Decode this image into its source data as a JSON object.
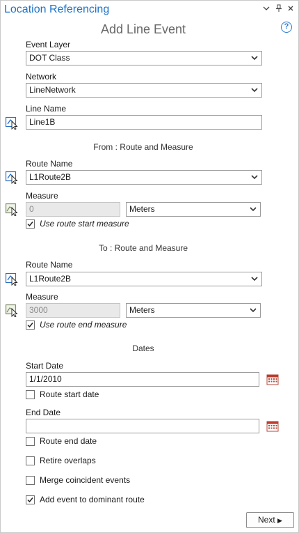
{
  "pane": {
    "title": "Location Referencing",
    "subtitle": "Add Line Event",
    "controls": [
      "dropdown-arrow",
      "pin",
      "close"
    ],
    "help_glyph": "?"
  },
  "event_layer": {
    "label": "Event Layer",
    "value": "DOT Class"
  },
  "network": {
    "label": "Network",
    "value": "LineNetwork"
  },
  "line_name": {
    "label": "Line Name",
    "value": "Line1B"
  },
  "from": {
    "heading": "From : Route and Measure",
    "route_label": "Route Name",
    "route_value": "L1Route2B",
    "measure_label": "Measure",
    "measure_value": "0",
    "units": "Meters",
    "use_measure_label": "Use route start measure",
    "use_measure_checked": true
  },
  "to": {
    "heading": "To : Route and Measure",
    "route_label": "Route Name",
    "route_value": "L1Route2B",
    "measure_label": "Measure",
    "measure_value": "3000",
    "units": "Meters",
    "use_measure_label": "Use route end measure",
    "use_measure_checked": true
  },
  "dates": {
    "heading": "Dates",
    "start_label": "Start Date",
    "start_value": "1/1/2010",
    "route_start_label": "Route start date",
    "route_start_checked": false,
    "end_label": "End Date",
    "end_value": "",
    "route_end_label": "Route end date",
    "route_end_checked": false
  },
  "options": {
    "retire_overlaps_label": "Retire overlaps",
    "retire_overlaps_checked": false,
    "merge_label": "Merge coincident events",
    "merge_checked": false,
    "dominant_label": "Add event to dominant route",
    "dominant_checked": true
  },
  "footer": {
    "next_label": "Next",
    "next_glyph": "▶"
  },
  "colors": {
    "title_blue": "#1a73c9",
    "calendar_red": "#c0392b",
    "tool_blue": "#2a6fc4"
  },
  "icons": {
    "route_picker": "select-route-on-map-icon",
    "measure_picker": "pick-measure-on-map-icon",
    "calendar": "calendar-icon",
    "dropdown": "chevron-down-icon"
  }
}
